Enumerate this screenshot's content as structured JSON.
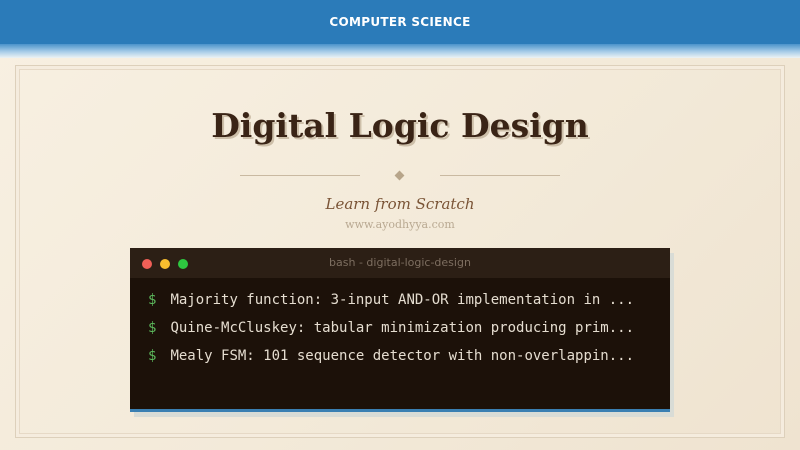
{
  "header": {
    "category": "COMPUTER SCIENCE"
  },
  "hero": {
    "title": "Digital Logic Design",
    "subtitle": "Learn from Scratch",
    "website": "www.ayodhyya.com"
  },
  "terminal": {
    "title": "bash - digital-logic-design",
    "prompt_symbol": "$",
    "lines": [
      "Majority function: 3-input AND-OR implementation in ...",
      "Quine-McCluskey: tabular minimization producing prim...",
      "Mealy FSM: 101 sequence detector with non-overlappin..."
    ],
    "window_buttons": [
      "close",
      "minimize",
      "maximize"
    ]
  },
  "colors": {
    "header_blue": "#2b7bb9",
    "title_brown": "#3a2416",
    "terminal_bg": "#1c1109",
    "prompt_green": "#5cb85c",
    "accent_blue": "#3a7fb2"
  }
}
